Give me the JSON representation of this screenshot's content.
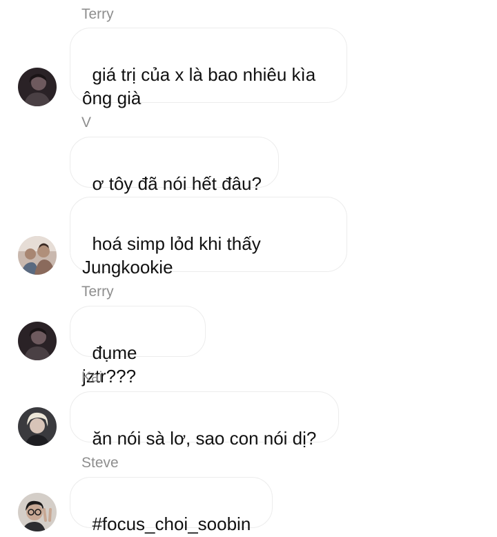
{
  "messages": [
    {
      "sender": "Terry",
      "text": "giá trị của x là bao nhiêu kìa\nông già",
      "avatar": "dark-haired-avatar-icon"
    },
    {
      "sender": "V",
      "text": "ơ tôy đã nói hết đâu?",
      "avatar": ""
    },
    {
      "sender": "",
      "text": "hoá simp lỏd khi thấy\nJungkookie",
      "avatar": "friends-group-avatar-icon"
    },
    {
      "sender": "Terry",
      "text": "đụme jztr???",
      "avatar": "dark-haired-avatar-icon"
    },
    {
      "sender": "Kai",
      "text": "ăn nói sà lơ, sao con nói dị?",
      "avatar": "blonde-avatar-icon"
    },
    {
      "sender": "Steve",
      "text": "#focus_choi_soobin",
      "avatar": "glasses-peace-sign-avatar-icon"
    }
  ]
}
